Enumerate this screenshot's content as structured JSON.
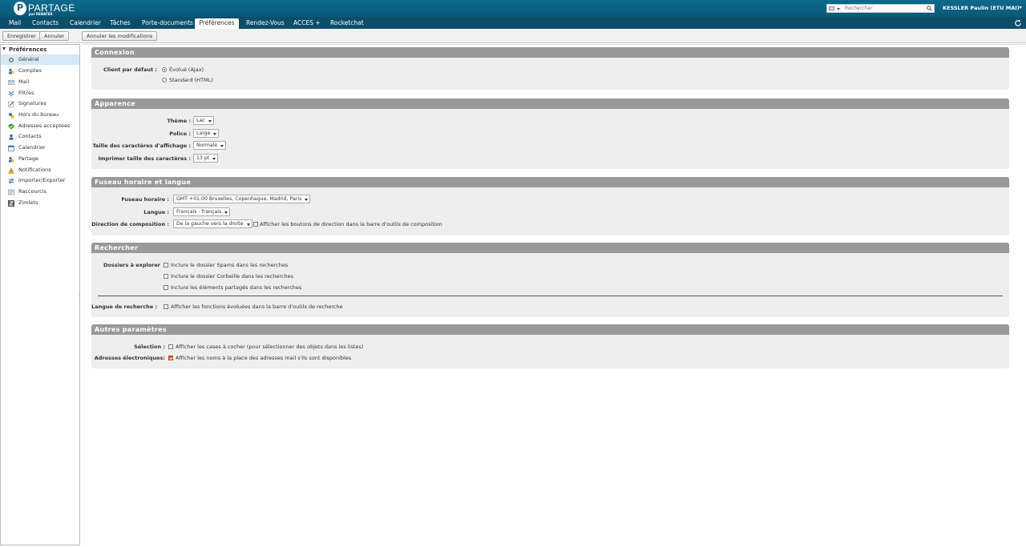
{
  "header": {
    "logo_text": "PARTAGE",
    "logo_sub": "par RENATER",
    "search_placeholder": "Rechercher",
    "user_name": "KESSLER Paulin (ETU MAI)"
  },
  "tabs": [
    {
      "label": "Mail"
    },
    {
      "label": "Contacts"
    },
    {
      "label": "Calendrier"
    },
    {
      "label": "Tâches"
    },
    {
      "label": "Porte-documents"
    },
    {
      "label": "Préférences"
    },
    {
      "label": "Rendez-Vous"
    },
    {
      "label": "ACCES +"
    },
    {
      "label": "Rocketchat"
    }
  ],
  "active_tab": "Préférences",
  "toolbar": {
    "save_label": "Enregistrer",
    "cancel_label": "Annuler",
    "undo_label": "Annuler les modifications"
  },
  "sidebar": {
    "root_label": "Préférences",
    "items": [
      {
        "label": "Général",
        "icon": "gear-icon",
        "selected": true
      },
      {
        "label": "Comptes",
        "icon": "accounts-icon"
      },
      {
        "label": "Mail",
        "icon": "mail-icon"
      },
      {
        "label": "Filtres",
        "icon": "filter-icon"
      },
      {
        "label": "Signatures",
        "icon": "signature-icon"
      },
      {
        "label": "Hors du bureau",
        "icon": "out-of-office-icon"
      },
      {
        "label": "Adresses acceptées",
        "icon": "shield-check-icon"
      },
      {
        "label": "Contacts",
        "icon": "contacts-icon"
      },
      {
        "label": "Calendrier",
        "icon": "calendar-icon"
      },
      {
        "label": "Partage",
        "icon": "share-icon"
      },
      {
        "label": "Notifications",
        "icon": "bell-icon"
      },
      {
        "label": "Importer/Exporter",
        "icon": "import-export-icon"
      },
      {
        "label": "Raccourcis",
        "icon": "shortcuts-icon"
      },
      {
        "label": "Zimlets",
        "icon": "zimlet-icon"
      }
    ]
  },
  "sections": {
    "connexion": {
      "title": "Connexion",
      "client_label": "Client par défaut :",
      "opt_ajax": "Évolué (Ajax)",
      "opt_html": "Standard (HTML)",
      "selected": "ajax"
    },
    "apparence": {
      "title": "Apparence",
      "theme_label": "Thème :",
      "theme_value": "Lac",
      "font_label": "Police :",
      "font_value": "Large",
      "size_label": "Taille des caractères d'affichage :",
      "size_value": "Normale",
      "print_label": "Imprimer taille des caractères :",
      "print_value": "13 pt"
    },
    "fuseau": {
      "title": "Fuseau horaire et langue",
      "tz_label": "Fuseau horaire :",
      "tz_value": "GMT +01:00 Bruxelles, Copenhague, Madrid, Paris",
      "lang_label": "Langue :",
      "lang_value": "Français - français",
      "dir_label": "Direction de composition :",
      "dir_value": "De la gauche vers la droite",
      "dir_cb_label": "Afficher les boutons de direction dans la barre d'outils de composition"
    },
    "rechercher": {
      "title": "Rechercher",
      "folders_label": "Dossiers à explorer",
      "cb_spam": "Inclure le dossier Spams dans les recherches",
      "cb_trash": "Inclure le dossier Corbeille dans les recherches",
      "cb_shared": "Inclure les éléments partagés dans les recherches",
      "lang_label": "Langue de recherche :",
      "cb_advanced": "Afficher les fonctions évoluées dans la barre d'outils de recherche"
    },
    "autres": {
      "title": "Autres paramètres",
      "selection_label": "Sélection :",
      "selection_cb": "Afficher les cases à cocher (pour sélectionner des objets dans les listes)",
      "addresses_label": "Adresses électroniques:",
      "addresses_cb": "Afficher les noms à la place des adresses mail s'ils sont disponibles"
    }
  },
  "colors": {
    "header_bg": "#0b5f80",
    "tabbar_bg": "#0a4e6b",
    "section_header": "#999999",
    "section_bg": "#eeeeee",
    "accent_orange": "#e05a2b",
    "selected_item": "#d6e8f5"
  }
}
